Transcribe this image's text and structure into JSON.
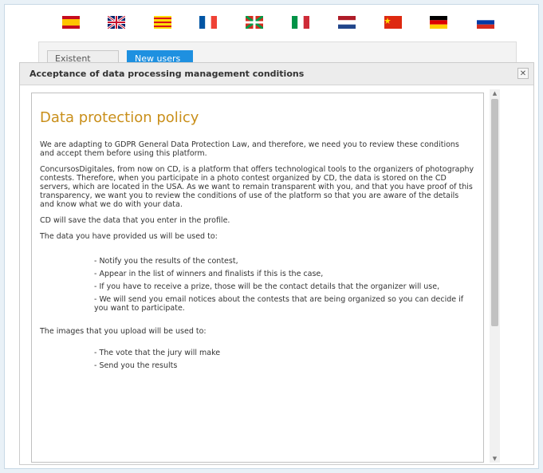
{
  "flags": [
    {
      "name": "spanish-flag",
      "lang": "es"
    },
    {
      "name": "uk-flag",
      "lang": "en"
    },
    {
      "name": "catalan-flag",
      "lang": "ca"
    },
    {
      "name": "french-flag",
      "lang": "fr"
    },
    {
      "name": "basque-flag",
      "lang": "eu"
    },
    {
      "name": "italian-flag",
      "lang": "it"
    },
    {
      "name": "dutch-flag",
      "lang": "nl"
    },
    {
      "name": "chinese-flag",
      "lang": "zh"
    },
    {
      "name": "german-flag",
      "lang": "de"
    },
    {
      "name": "russian-flag",
      "lang": "ru"
    }
  ],
  "tabs": [
    {
      "label": "Existent users"
    },
    {
      "label": "New users"
    }
  ],
  "dialog": {
    "title": "Acceptance of data processing management conditions",
    "close_icon": "✕"
  },
  "policy": {
    "heading": "Data protection policy",
    "intro": "We are adapting to GDPR General Data Protection Law, and therefore, we need you to review these conditions and accept them before using this platform.",
    "about": "ConcursosDigitales, from now on CD, is a platform that offers technological tools to the organizers of photography contests. Therefore, when you participate in a photo contest organized by CD, the data is stored on the CD servers, which are located in the USA. As we want to remain transparent with you, and that you have proof of this transparency, we want you to review the conditions of use of the platform so that you are aware of the details and know what we do with your data.",
    "save_profile": "CD will save the data that you enter in the profile.",
    "data_used_intro": "The data you have provided us will be used to:",
    "data_uses": [
      "- Notify you the results of the contest,",
      "- Appear in the list of winners and finalists if this is the case,",
      "- If you have to receive a prize, those will be the contact details that the organizer will use,",
      "- We will send you email notices about the contests that are being organized so you can decide if you want to participate."
    ],
    "images_intro": "The images that you upload will be used to:",
    "image_uses": [
      "- The vote that the jury will make",
      "- Send you the results"
    ]
  },
  "colors": {
    "accent": "#1e90e0",
    "heading": "#c98f1a"
  }
}
